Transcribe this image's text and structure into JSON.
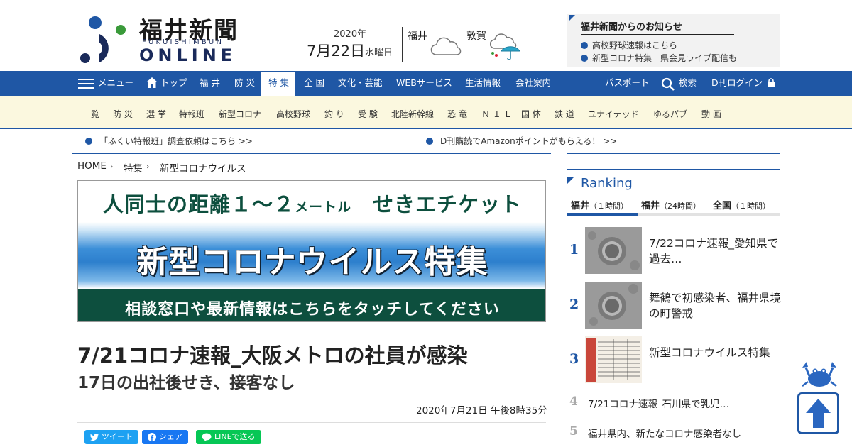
{
  "header": {
    "logo_jp": "福井新聞",
    "logo_en_small": "FUKUISHIMBUN",
    "logo_en_big": "ONLINE",
    "date_year": "2020年",
    "date_day": "7月22日",
    "date_weekday": "水曜日",
    "weather": [
      {
        "city": "福井",
        "icon": "cloud-icon"
      },
      {
        "city": "敦賀",
        "icon": "cloud-rain-umbrella-icon"
      }
    ],
    "notice": {
      "title": "福井新聞からのお知らせ",
      "items": [
        "高校野球速報はこちら",
        "新型コロナ特集　県会見ライブ配信も"
      ]
    }
  },
  "nav": {
    "menu_label": "メニュー",
    "items": [
      "トップ",
      "福 井",
      "防 災",
      "特 集",
      "全 国",
      "文化・芸能",
      "WEBサービス",
      "生活情報",
      "会社案内"
    ],
    "active": "特 集",
    "right": {
      "passport": "パスポート",
      "search": "検索",
      "login": "D刊ログイン"
    }
  },
  "subnav": [
    "一 覧",
    "防 災",
    "選 挙",
    "特報班",
    "新型コロナ",
    "高校野球",
    "釣 り",
    "受 験",
    "北陸新幹線",
    "恐 竜",
    "Ｎ Ｉ Ｅ",
    "国 体",
    "鉄 道",
    "ユナイテッド",
    "ゆるパブ",
    "動 画"
  ],
  "ticker": [
    "「ふくい特報班」調査依頼はこちら >>",
    "D刊購読でAmazonポイントがもらえる！ >>"
  ],
  "breadcrumb": [
    "HOME",
    "特集",
    "新型コロナウイルス"
  ],
  "banner": {
    "top_a": "人同士の距離１～２",
    "top_b": "メートル",
    "top_c": "せきエチケット",
    "middle": "新型コロナウイルス特集",
    "bottom": "相談窓口や最新情報はこちらをタッチしてください"
  },
  "article": {
    "headline": "7/21コロナ速報_大阪メトロの社員が感染",
    "subhead": "17日の出社後せき、接客なし",
    "published": "2020年7月21日 午後8時35分"
  },
  "share": {
    "tweet": "ツイート",
    "facebook": "シェア",
    "line": "LINEで送る"
  },
  "ranking": {
    "title": "Ranking",
    "tabs": [
      {
        "name": "福井",
        "period": "（１時間）"
      },
      {
        "name": "福井",
        "period": "（24時間）"
      },
      {
        "name": "全国",
        "period": "（１時間）"
      }
    ],
    "items": [
      {
        "rank": "1",
        "title": "7/22コロナ速報_愛知県で過去…"
      },
      {
        "rank": "2",
        "title": "舞鶴で初感染者、福井県境の町警戒"
      },
      {
        "rank": "3",
        "title": "新型コロナウイルス特集"
      },
      {
        "rank": "4",
        "title": "7/21コロナ速報_石川県で乳児…"
      },
      {
        "rank": "5",
        "title": "福井県内、新たなコロナ感染者なし"
      }
    ]
  },
  "colors": {
    "brand_blue": "#1f57a5",
    "banner_green": "#0d4f3e",
    "subnav_bg": "#fbf8df",
    "logo_green": "#3a9a3a"
  }
}
